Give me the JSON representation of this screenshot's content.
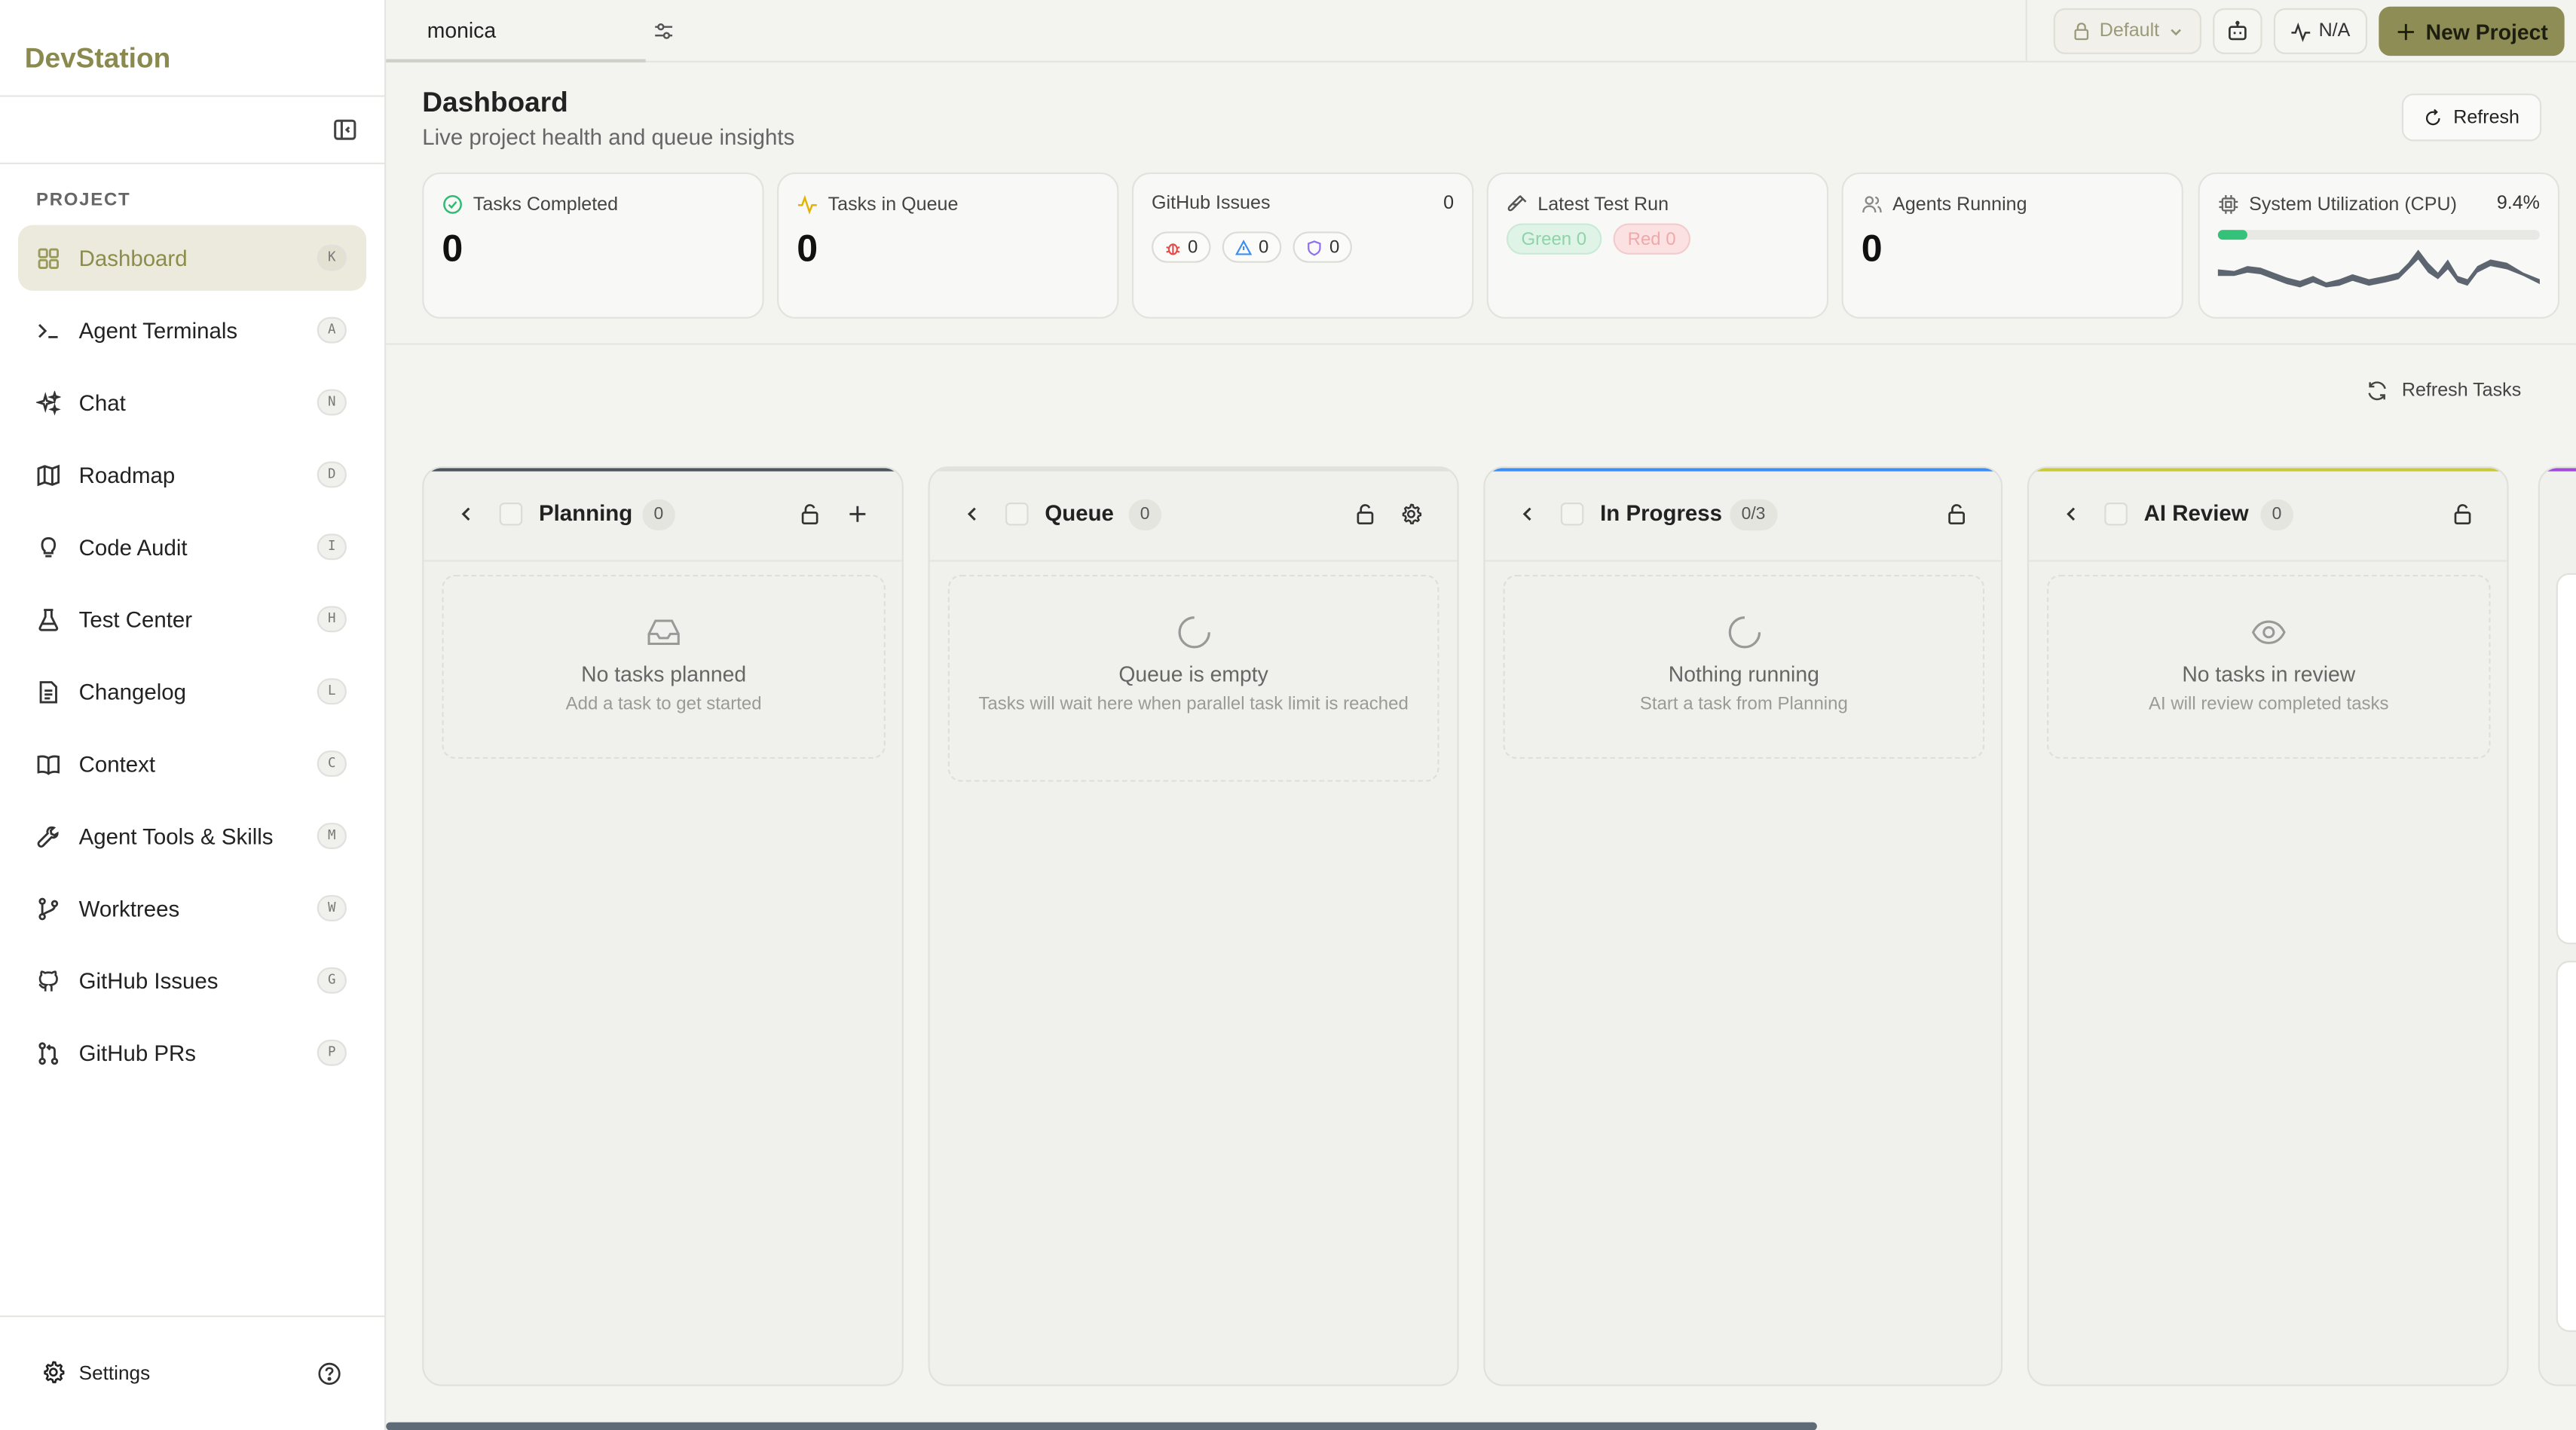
{
  "app": {
    "brand": "DevStation"
  },
  "sidebar": {
    "section_label": "PROJECT",
    "items": [
      {
        "label": "Dashboard",
        "key": "K",
        "icon": "grid-icon",
        "active": true
      },
      {
        "label": "Agent Terminals",
        "key": "A",
        "icon": "terminal-icon"
      },
      {
        "label": "Chat",
        "key": "N",
        "icon": "sparkles-icon"
      },
      {
        "label": "Roadmap",
        "key": "D",
        "icon": "map-icon"
      },
      {
        "label": "Code Audit",
        "key": "I",
        "icon": "lightbulb-icon"
      },
      {
        "label": "Test Center",
        "key": "H",
        "icon": "flask-icon"
      },
      {
        "label": "Changelog",
        "key": "L",
        "icon": "file-text-icon"
      },
      {
        "label": "Context",
        "key": "C",
        "icon": "book-icon"
      },
      {
        "label": "Agent Tools & Skills",
        "key": "M",
        "icon": "wrench-icon"
      },
      {
        "label": "Worktrees",
        "key": "W",
        "icon": "git-branch-icon"
      },
      {
        "label": "GitHub Issues",
        "key": "G",
        "icon": "github-icon"
      },
      {
        "label": "GitHub PRs",
        "key": "P",
        "icon": "git-pull-request-icon"
      }
    ],
    "settings_label": "Settings"
  },
  "topbar": {
    "tab_name": "monica",
    "default_label": "Default",
    "na_label": "N/A",
    "new_project_label": "New Project"
  },
  "header": {
    "title": "Dashboard",
    "subtitle": "Live project health and queue insights",
    "refresh_label": "Refresh"
  },
  "cards": {
    "tasks_completed": {
      "label": "Tasks Completed",
      "value": "0"
    },
    "tasks_in_queue": {
      "label": "Tasks in Queue",
      "value": "0"
    },
    "github_issues": {
      "label": "GitHub Issues",
      "total": "0",
      "bugs": "0",
      "warnings": "0",
      "security": "0"
    },
    "latest_test_run": {
      "label": "Latest Test Run",
      "green": "Green 0",
      "red": "Red 0"
    },
    "agents_running": {
      "label": "Agents Running",
      "value": "0"
    },
    "system_utilization": {
      "label": "System Utilization (CPU)",
      "value": "9.4%",
      "fraction": 0.094
    }
  },
  "board": {
    "refresh_tasks_label": "Refresh Tasks",
    "columns": [
      {
        "title": "Planning",
        "count": "0",
        "empty_title": "No tasks planned",
        "empty_sub": "Add a task to get started",
        "accent": "#4a5560"
      },
      {
        "title": "Queue",
        "count": "0",
        "empty_title": "Queue is empty",
        "empty_sub": "Tasks will wait here when parallel task limit is reached",
        "accent": "#e0e0dc"
      },
      {
        "title": "In Progress",
        "count": "0/3",
        "empty_title": "Nothing running",
        "empty_sub": "Start a task from Planning",
        "accent": "#3d8ef0"
      },
      {
        "title": "AI Review",
        "count": "0",
        "empty_title": "No tasks in review",
        "empty_sub": "AI will review completed tasks",
        "accent": "#c9c93a"
      }
    ]
  },
  "colors": {
    "brand": "#8a8a4e",
    "primary_button": "#8d8d55",
    "cpu_fill": "#34c17a"
  }
}
